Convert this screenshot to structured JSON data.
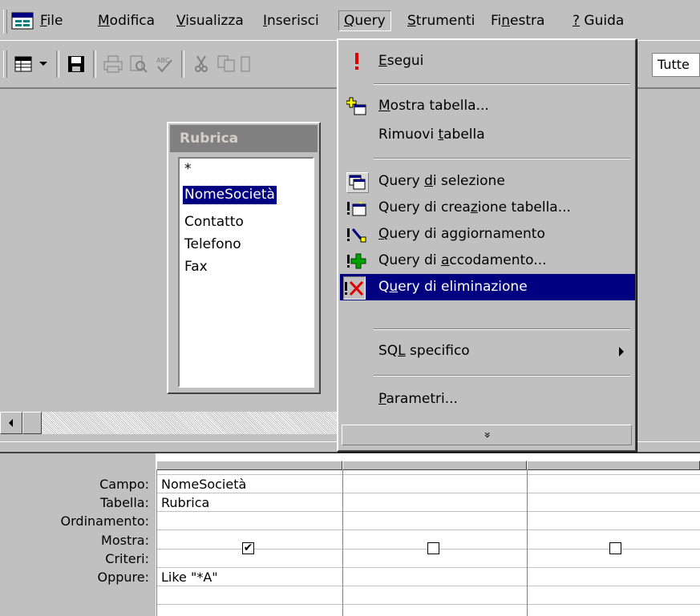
{
  "menubar": {
    "items": [
      {
        "pre": "",
        "acc": "F",
        "post": "ile"
      },
      {
        "pre": "",
        "acc": "M",
        "post": "odifica"
      },
      {
        "pre": "",
        "acc": "V",
        "post": "isualizza"
      },
      {
        "pre": "",
        "acc": "I",
        "post": "nserisci"
      },
      {
        "pre": "",
        "acc": "Q",
        "post": "uery"
      },
      {
        "pre": "",
        "acc": "S",
        "post": "trumenti"
      },
      {
        "pre": "Fi",
        "acc": "n",
        "post": "estra"
      },
      {
        "pre": "",
        "acc": "?",
        "post": " Guida"
      }
    ]
  },
  "toolbar": {
    "icons": [
      "view-icon",
      "dropdown-arrow-icon",
      "save-icon",
      "print-icon",
      "print-preview-icon",
      "spelling-icon",
      "cut-icon",
      "copy-icon"
    ],
    "combo_value": "Tutte"
  },
  "table": {
    "title": "Rubrica",
    "fields": [
      "*",
      "NomeSocietà",
      "Contatto",
      "Telefono",
      "Fax"
    ],
    "selected_index": 1
  },
  "query_menu": {
    "items": [
      {
        "pre": "",
        "acc": "E",
        "post": "segui",
        "icon": "exclamation-icon"
      },
      {
        "pre": "",
        "acc": "M",
        "post": "ostra tabella...",
        "icon": "show-table-icon"
      },
      {
        "pre": "Rimuovi ",
        "acc": "t",
        "post": "abella",
        "icon": ""
      },
      {
        "pre": "Query ",
        "acc": "d",
        "post": "i selezione",
        "icon": "select-query-icon"
      },
      {
        "pre": "Query di crea",
        "acc": "z",
        "post": "ione tabella...",
        "icon": "make-table-query-icon"
      },
      {
        "pre": "",
        "acc": "Q",
        "post": "uery di aggiornamento",
        "icon": "update-query-icon"
      },
      {
        "pre": "Query di ",
        "acc": "a",
        "post": "ccodamento...",
        "icon": "append-query-icon"
      },
      {
        "pre": "Q",
        "acc": "u",
        "post": "ery di eliminazione",
        "icon": "delete-query-icon"
      },
      {
        "pre": "SQ",
        "acc": "L",
        "post": " specifico",
        "icon": ""
      },
      {
        "pre": "",
        "acc": "P",
        "post": "arametri...",
        "icon": ""
      }
    ],
    "highlighted_index": 7,
    "expand_glyph": "»"
  },
  "grid": {
    "row_labels": [
      "Campo:",
      "Tabella:",
      "Ordinamento:",
      "Mostra:",
      "Criteri:",
      "Oppure:"
    ],
    "columns": [
      {
        "campo": "NomeSocietà",
        "tabella": "Rubrica",
        "ordinamento": "",
        "mostra": true,
        "criteri": "Like \"*A\"",
        "oppure": ""
      },
      {
        "campo": "",
        "tabella": "",
        "ordinamento": "",
        "mostra": false,
        "criteri": "",
        "oppure": ""
      },
      {
        "campo": "",
        "tabella": "",
        "ordinamento": "",
        "mostra": false,
        "criteri": "",
        "oppure": ""
      }
    ]
  }
}
